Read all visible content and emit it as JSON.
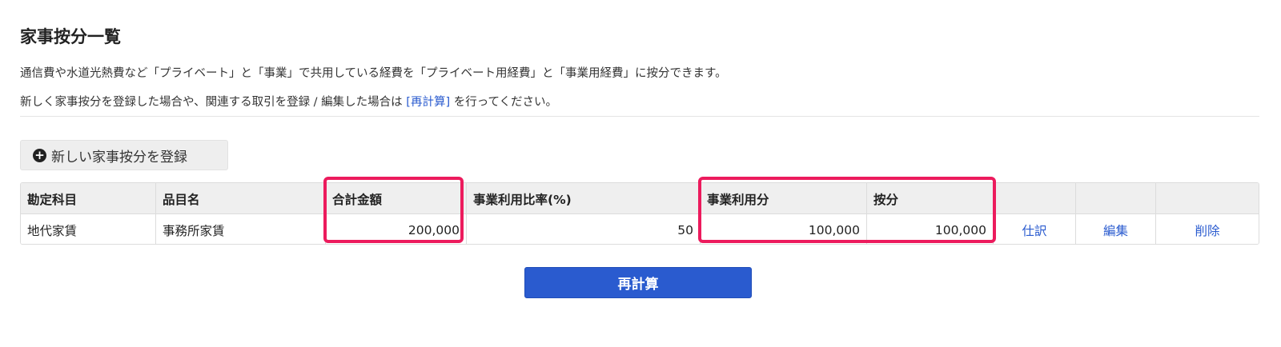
{
  "page": {
    "title": "家事按分一覧",
    "description_line1": "通信費や水道光熱費など「プライベート」と「事業」で共用している経費を「プライベート用経費」と「事業用経費」に按分できます。",
    "description_line2_before": "新しく家事按分を登録した場合や、関連する取引を登録 / 編集した場合は ",
    "description_line2_link": "[再計算]",
    "description_line2_after": " を行ってください。"
  },
  "toolbar": {
    "new_button_label": "新しい家事按分を登録",
    "new_button_icon": "plus-circle-icon"
  },
  "table": {
    "headers": [
      "勘定科目",
      "品目名",
      "合計金額",
      "事業利用比率(%)",
      "事業利用分",
      "按分",
      "",
      "",
      ""
    ],
    "rows": [
      {
        "account": "地代家賃",
        "item": "事務所家賃",
        "total": "200,000",
        "ratio": "50",
        "business_use": "100,000",
        "allocation": "100,000",
        "journal_link": "仕訳",
        "edit_link": "編集",
        "delete_link": "削除"
      }
    ]
  },
  "actions": {
    "recalculate_label": "再計算"
  },
  "colors": {
    "accent": "#2a5bcf",
    "highlight": "#ec1b5d",
    "header_bg": "#efefef"
  }
}
